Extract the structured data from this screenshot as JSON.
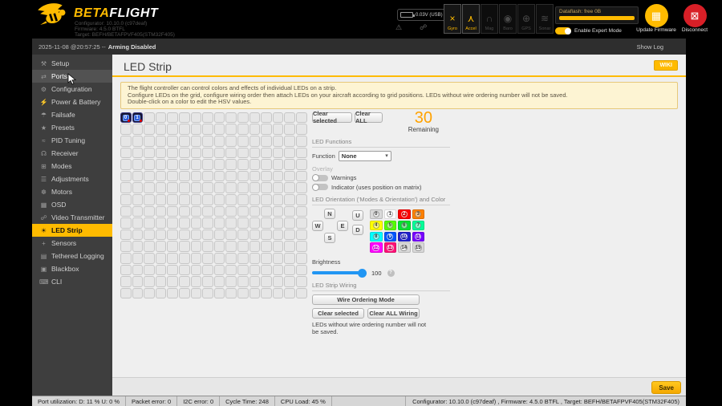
{
  "colors": {
    "accent": "#ffbb00",
    "disconnect_red": "#d81f27",
    "slider_blue": "#2196f3",
    "remaining_orange": "#ffa200"
  },
  "header": {
    "brand_beta": "BETA",
    "brand_flight": "FLIGHT",
    "version_lines": [
      "Configurator: 10.10.0 (c97deaf)",
      "Firmware: 4.5.0 BTFL",
      "Target: BEFH/BETAFPVF405(STM32F405)"
    ],
    "battery_voltage": "0.03V (USB)",
    "status_icons": [
      {
        "name": "warning-icon",
        "glyph": "⚠",
        "active": false
      },
      {
        "name": "gps-signal-icon",
        "glyph": "☍",
        "active": false
      },
      {
        "name": "log-link-icon",
        "glyph": "∮",
        "active": true
      }
    ],
    "sensors": [
      {
        "label": "Gyro",
        "glyph": "×",
        "active": true
      },
      {
        "label": "Accel",
        "glyph": "⋏",
        "active": true
      },
      {
        "label": "Mag",
        "glyph": "∩",
        "active": false
      },
      {
        "label": "Baro",
        "glyph": "◉",
        "active": false
      },
      {
        "label": "GPS",
        "glyph": "⊕",
        "active": false
      },
      {
        "label": "Sonar",
        "glyph": "≋",
        "active": false
      }
    ],
    "dataflash_label": "Dataflash: free 0B",
    "expert_mode_label": "Enable Expert Mode",
    "update_firmware_label": "Update Firmware",
    "disconnect_label": "Disconnect"
  },
  "logbar": {
    "timestamp": "2025-11-08 @20:57:25 --",
    "status": "Arming Disabled",
    "show_log": "Show Log"
  },
  "sidebar": {
    "items": [
      {
        "label": "Setup",
        "glyph": "⚒",
        "state": "normal"
      },
      {
        "label": "Ports",
        "glyph": "⇄",
        "state": "hover"
      },
      {
        "label": "Configuration",
        "glyph": "⚙",
        "state": "normal"
      },
      {
        "label": "Power & Battery",
        "glyph": "⚡",
        "state": "normal"
      },
      {
        "label": "Failsafe",
        "glyph": "☂",
        "state": "normal"
      },
      {
        "label": "Presets",
        "glyph": "★",
        "state": "normal"
      },
      {
        "label": "PID Tuning",
        "glyph": "≈",
        "state": "normal"
      },
      {
        "label": "Receiver",
        "glyph": "☊",
        "state": "normal"
      },
      {
        "label": "Modes",
        "glyph": "⊞",
        "state": "normal"
      },
      {
        "label": "Adjustments",
        "glyph": "☰",
        "state": "normal"
      },
      {
        "label": "Motors",
        "glyph": "☸",
        "state": "normal"
      },
      {
        "label": "OSD",
        "glyph": "▦",
        "state": "normal"
      },
      {
        "label": "Video Transmitter",
        "glyph": "☍",
        "state": "normal"
      },
      {
        "label": "LED Strip",
        "glyph": "☀",
        "state": "active"
      },
      {
        "label": "Sensors",
        "glyph": "+",
        "state": "normal"
      },
      {
        "label": "Tethered Logging",
        "glyph": "▤",
        "state": "normal"
      },
      {
        "label": "Blackbox",
        "glyph": "▣",
        "state": "normal"
      },
      {
        "label": "CLI",
        "glyph": "⌨",
        "state": "normal"
      }
    ]
  },
  "main": {
    "title": "LED Strip",
    "wiki_label": "WIKI",
    "note_lines": [
      "The flight controller can control colors and effects of individual LEDs on a strip.",
      "Configure LEDs on the grid, configure wiring order then attach LEDs on your aircraft according to grid positions. LEDs without wire ordering number will not be saved.",
      "Double-click on a color to edit the HSV values."
    ],
    "grid": {
      "rows": 16,
      "cols": 16,
      "wired": [
        {
          "cell": 0,
          "label": "0"
        },
        {
          "cell": 1,
          "label": "1"
        }
      ]
    },
    "toolbar": {
      "clear_selected": "Clear selected",
      "clear_all": "Clear ALL"
    },
    "remaining": {
      "count": "30",
      "label": "Remaining"
    },
    "functions": {
      "header": "LED Functions",
      "function_label": "Function",
      "selected": "None"
    },
    "overlay": {
      "label": "Overlay",
      "toggles": [
        {
          "label": "Warnings",
          "on": false
        },
        {
          "label": "Indicator (uses position on matrix)",
          "on": false
        }
      ]
    },
    "orientation": {
      "header": "LED Orientation ('Modes & Orientation') and Color",
      "compass": [
        {
          "label": "N",
          "pos": "n"
        },
        {
          "label": "W",
          "pos": "w"
        },
        {
          "label": "E",
          "pos": "e"
        },
        {
          "label": "S",
          "pos": "s"
        }
      ],
      "updown": [
        {
          "label": "U",
          "pos": "u"
        },
        {
          "label": "D",
          "pos": "d"
        }
      ],
      "palette": [
        {
          "label": "0",
          "hex": "#d9d9d9",
          "dark": false
        },
        {
          "label": "1",
          "hex": "#ffffff",
          "dark": false
        },
        {
          "label": "2",
          "hex": "#ff0000",
          "dark": true
        },
        {
          "label": "3",
          "hex": "#ff8000",
          "dark": false
        },
        {
          "label": "4",
          "hex": "#ffff00",
          "dark": false
        },
        {
          "label": "5",
          "hex": "#55ff00",
          "dark": false
        },
        {
          "label": "6",
          "hex": "#00e52e",
          "dark": false
        },
        {
          "label": "7",
          "hex": "#00ff99",
          "dark": false
        },
        {
          "label": "8",
          "hex": "#00ffff",
          "dark": false
        },
        {
          "label": "9",
          "hex": "#0055ff",
          "dark": true
        },
        {
          "label": "10",
          "hex": "#2222cc",
          "dark": true
        },
        {
          "label": "11",
          "hex": "#7700ff",
          "dark": true
        },
        {
          "label": "12",
          "hex": "#ff00ff",
          "dark": true
        },
        {
          "label": "13",
          "hex": "#ff1177",
          "dark": true
        },
        {
          "label": "14",
          "hex": "#d9d9d9",
          "dark": false
        },
        {
          "label": "15",
          "hex": "#d9d9d9",
          "dark": false
        }
      ]
    },
    "brightness": {
      "label": "Brightness",
      "value": "100",
      "help": "?"
    },
    "wiring": {
      "header": "LED Strip Wiring",
      "wire_mode": "Wire Ordering Mode",
      "clear_selected": "Clear selected",
      "clear_all": "Clear ALL Wiring",
      "note": "LEDs without wire ordering number will not be saved."
    },
    "save_label": "Save"
  },
  "footer": {
    "items": [
      "Port utilization: D: 11 % U: 0 %",
      "Packet error: 0",
      "I2C error: 0",
      "Cycle Time: 248",
      "CPU Load: 45 %"
    ],
    "right": "Configurator: 10.10.0 (c97deaf) , Firmware: 4.5.0 BTFL , Target: BEFH/BETAFPVF405(STM32F405)"
  }
}
